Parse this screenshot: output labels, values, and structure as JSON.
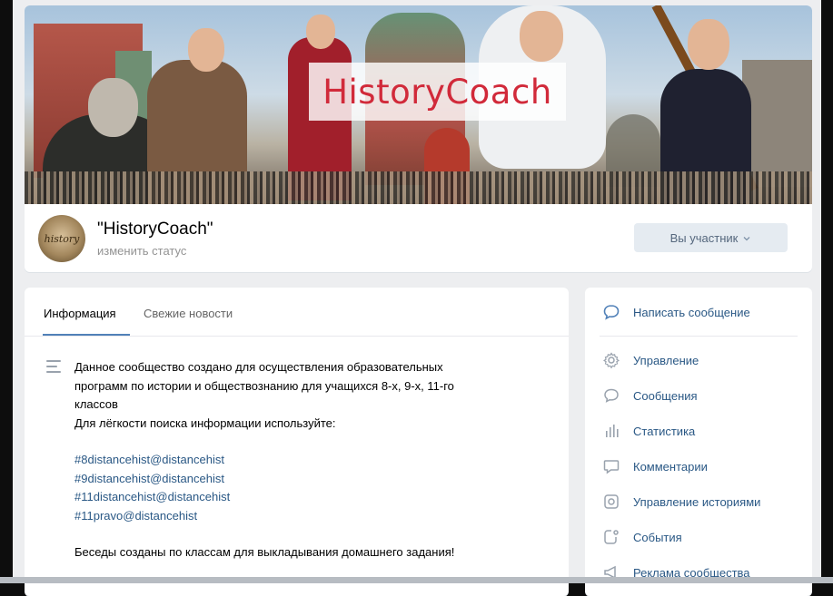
{
  "cover": {
    "title": "HistoryCoach"
  },
  "group": {
    "avatar_text": "history",
    "name": "\"HistoryCoach\"",
    "status": "изменить статус",
    "member_button": "Вы участник"
  },
  "tabs": [
    {
      "label": "Информация"
    },
    {
      "label": "Свежие новости"
    }
  ],
  "description": {
    "line1": "Данное сообщество создано для осуществления образовательных",
    "line2": "программ по истории и обществознанию для учащихся 8-х, 9-х, 11-го",
    "line3": "классов",
    "line4": "Для лёгкости поиска информации используйте:",
    "tags": [
      "#8distancehist@distancehist",
      "#9distancehist@distancehist",
      "#11distancehist@distancehist",
      "#11pravo@distancehist"
    ],
    "footer": "Беседы созданы по классам для выкладывания домашнего задания!"
  },
  "sidebar": {
    "primary": {
      "label": "Написать сообщение",
      "icon": "message-bubble-icon"
    },
    "items": [
      {
        "label": "Управление",
        "icon": "gear-icon"
      },
      {
        "label": "Сообщения",
        "icon": "chat-icon"
      },
      {
        "label": "Статистика",
        "icon": "bar-chart-icon"
      },
      {
        "label": "Комментарии",
        "icon": "comment-icon"
      },
      {
        "label": "Управление историями",
        "icon": "story-icon"
      },
      {
        "label": "События",
        "icon": "event-icon"
      },
      {
        "label": "Реклама сообщества",
        "icon": "megaphone-icon"
      }
    ]
  },
  "colors": {
    "link": "#2a5885",
    "accent": "#5181b8",
    "cover_title": "#d12a3a",
    "page_bg": "#edeef0"
  }
}
